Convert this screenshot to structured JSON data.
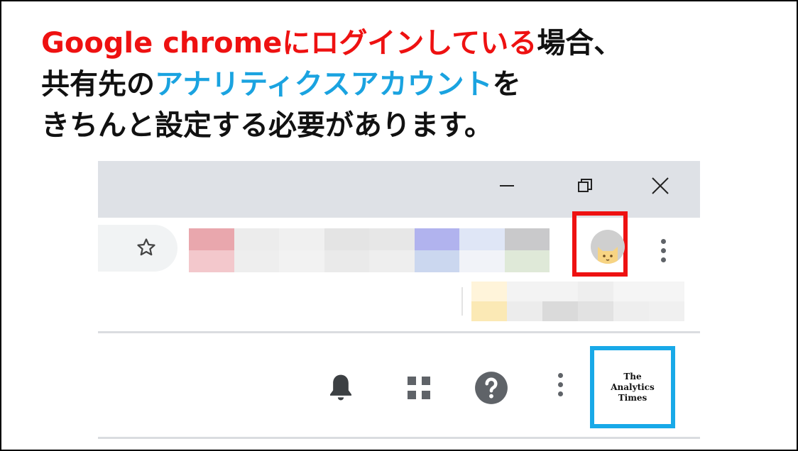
{
  "headline": {
    "line1": {
      "part1": "Google chromeにログインしている",
      "part2": "場合、"
    },
    "line2": {
      "part1": "共有先の",
      "part2": "アナリティクスアカウント",
      "part3": "を"
    },
    "line3": "きちんと設定する必要があります。"
  },
  "colors": {
    "emphasis_red": "#ee1111",
    "emphasis_blue": "#1aa3e0",
    "highlight_red": "#ee1111",
    "highlight_blue": "#18a9e8"
  },
  "browser": {
    "window_controls": [
      "minimize-icon",
      "restore-icon",
      "close-icon"
    ],
    "toolbar_icons": [
      "star-icon",
      "profile-avatar",
      "more-vert-icon"
    ],
    "extension_tiles": [
      "#e9a7ad",
      "#ececec",
      "#f0f0f0",
      "#e4e4e4",
      "#e7e7e7",
      "#b1b3ee",
      "#dfe6f6",
      "#c9c9cb",
      "#f3c8cc",
      "#eeeeee",
      "#f2f2f2",
      "#eaeaea",
      "#eeeeee",
      "#cbd7ef",
      "#f1f3f8",
      "#dfe9d8"
    ],
    "bookmark_tiles": [
      "#fff4da",
      "#f3f3f3",
      "#f3f3f3",
      "#eeeeee",
      "#f5f5f5",
      "#f5f5f5",
      "#fbe9b5",
      "#ececec",
      "#dadada",
      "#e2e2e2",
      "#eeeeee",
      "#f0f0f0"
    ]
  },
  "analytics_bar": {
    "icons": [
      "notifications-icon",
      "apps-icon",
      "help-icon",
      "more-vert-icon"
    ],
    "account_logo": {
      "line1": "The",
      "line2": "Analytics",
      "line3": "Times"
    }
  }
}
